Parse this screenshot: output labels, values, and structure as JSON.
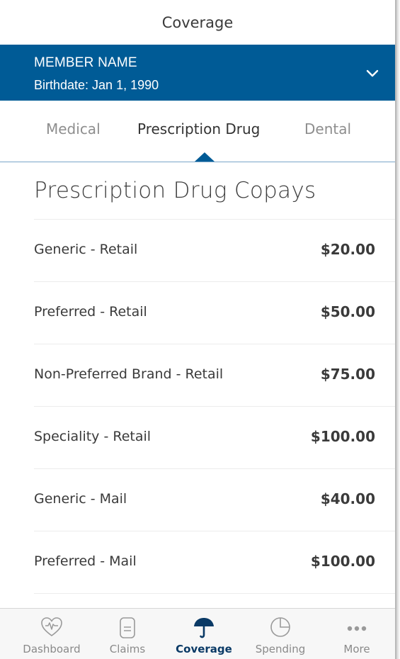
{
  "header": {
    "title": "Coverage"
  },
  "member": {
    "name": "MEMBER NAME",
    "birthdate": "Birthdate: Jan 1, 1990",
    "expand_icon": "chevron-down-icon"
  },
  "tabs": [
    {
      "label": "Medical",
      "active": false
    },
    {
      "label": "Prescription Drug",
      "active": true
    },
    {
      "label": "Dental",
      "active": false
    }
  ],
  "section": {
    "title": "Prescription Drug Copays"
  },
  "copays": [
    {
      "label": "Generic - Retail",
      "value": "$20.00"
    },
    {
      "label": "Preferred - Retail",
      "value": "$50.00"
    },
    {
      "label": "Non-Preferred Brand - Retail",
      "value": "$75.00"
    },
    {
      "label": "Speciality - Retail",
      "value": "$100.00"
    },
    {
      "label": "Generic - Mail",
      "value": "$40.00"
    },
    {
      "label": "Preferred - Mail",
      "value": "$100.00"
    }
  ],
  "bottom_nav": [
    {
      "label": "Dashboard",
      "icon": "heart-pulse-icon",
      "active": false
    },
    {
      "label": "Claims",
      "icon": "document-icon",
      "active": false
    },
    {
      "label": "Coverage",
      "icon": "umbrella-icon",
      "active": true
    },
    {
      "label": "Spending",
      "icon": "pie-chart-icon",
      "active": false
    },
    {
      "label": "More",
      "icon": "more-dots-icon",
      "active": false
    }
  ],
  "colors": {
    "brand_blue": "#005b96",
    "active_nav": "#0a3a66",
    "inactive_text": "#8e8e8e"
  }
}
